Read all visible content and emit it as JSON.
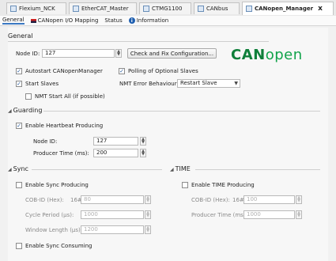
{
  "tabs": [
    {
      "label": "Flexium_NCK"
    },
    {
      "label": "EtherCAT_Master"
    },
    {
      "label": "CTMG1100"
    },
    {
      "label": "CANbus"
    },
    {
      "label": "CANopen_Manager"
    }
  ],
  "close_glyph": "x",
  "subtabs": [
    {
      "label": "General"
    },
    {
      "label": "CANopen I/O Mapping"
    },
    {
      "label": "Status"
    },
    {
      "label": "Information"
    }
  ],
  "general": {
    "title": "General",
    "node_id_label": "Node ID:",
    "node_id_value": "127",
    "check_button": "Check and Fix Configuration...",
    "logo_can": "CAN",
    "logo_open": "open",
    "autostart_label": "Autostart CANopenManager",
    "autostart_checked": true,
    "polling_label": "Polling of Optional Slaves",
    "polling_checked": true,
    "start_slaves_label": "Start Slaves",
    "start_slaves_checked": true,
    "nmt_error_label": "NMT Error Behaviour:",
    "nmt_error_value": "Restart Slave",
    "nmt_start_all_label": "NMT Start All (if possible)",
    "nmt_start_all_checked": false
  },
  "guarding": {
    "title": "Guarding",
    "heartbeat_label": "Enable Heartbeat Producing",
    "heartbeat_checked": true,
    "node_id_label": "Node ID:",
    "node_id_value": "127",
    "producer_time_label": "Producer Time (ms):",
    "producer_time_value": "200"
  },
  "sync": {
    "title": "Sync",
    "enable_producing_label": "Enable Sync Producing",
    "cobid_label": "COB-ID (Hex):",
    "cobid_prefix": "16#",
    "cobid_value": "80",
    "cycle_label": "Cycle Period (µs):",
    "cycle_value": "1000",
    "window_label": "Window Length (µs):",
    "window_value": "1200",
    "consuming_label": "Enable Sync Consuming"
  },
  "time": {
    "title": "TIME",
    "enable_producing_label": "Enable TIME Producing",
    "cobid_label": "COB-ID (Hex):",
    "cobid_prefix": "16#",
    "cobid_value": "100",
    "producer_time_label": "Producer Time (ms):",
    "producer_time_value": "1000"
  }
}
